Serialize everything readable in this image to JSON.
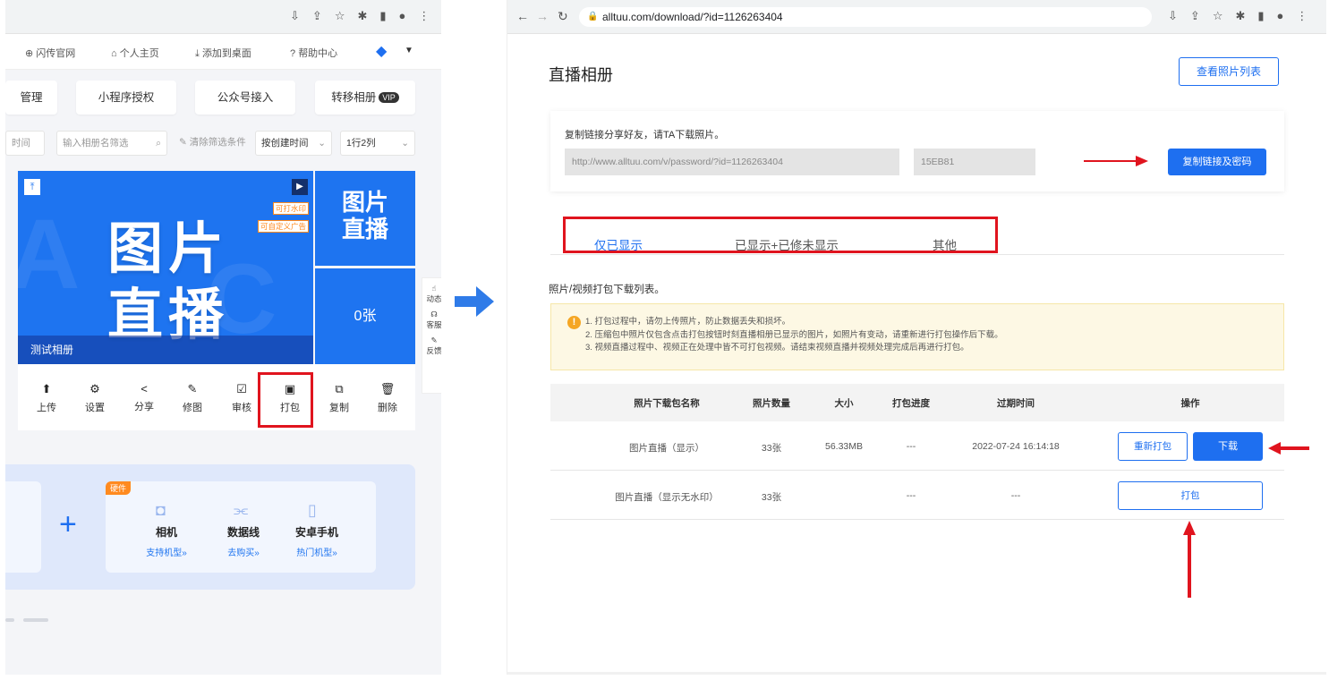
{
  "left_panel": {
    "nav": {
      "official_site": "闪传官网",
      "personal_home": "个人主页",
      "add_to_desktop": "添加到桌面",
      "help_center": "帮助中心"
    },
    "nav_icons": [
      "globe-icon",
      "home-icon",
      "download-icon",
      "help-icon"
    ],
    "cards": {
      "manage": "管理",
      "miniprogram_auth": "小程序授权",
      "official_account": "公众号接入",
      "transfer_album": "转移相册",
      "vip_badge": "VIP"
    },
    "filters": {
      "time_stub": "时间",
      "search_placeholder": "输入相册名筛选",
      "clear_filters": "清除筛选条件",
      "sort_by": "按创建时间",
      "layout": "1行2列"
    },
    "cover": {
      "title_line1": "图片",
      "title_line2": "直播",
      "tag_watermark": "可打水印",
      "tag_custom_ad": "可自定义广告",
      "caption": "测试相册"
    },
    "side_tiles": {
      "top_line1": "图片",
      "top_line2": "直播",
      "count": "0张"
    },
    "float_rail": {
      "activity": "动态",
      "service": "客服",
      "feedback": "反馈"
    },
    "tools": [
      {
        "label": "上传",
        "icon": "upload-icon"
      },
      {
        "label": "设置",
        "icon": "gear-icon"
      },
      {
        "label": "分享",
        "icon": "share-icon"
      },
      {
        "label": "修图",
        "icon": "edit-image-icon"
      },
      {
        "label": "审核",
        "icon": "review-icon"
      },
      {
        "label": "打包",
        "icon": "package-icon"
      },
      {
        "label": "复制",
        "icon": "copy-icon"
      },
      {
        "label": "删除",
        "icon": "trash-icon"
      }
    ],
    "hardware": {
      "badge": "硬件",
      "items": [
        {
          "name": "相机",
          "link": "支持机型»"
        },
        {
          "name": "数据线",
          "link": "去购买»"
        },
        {
          "name": "安卓手机",
          "link": "热门机型»"
        }
      ]
    }
  },
  "right_panel": {
    "browser": {
      "url": "alltuu.com/download/?id=1126263404"
    },
    "page_title": "直播相册",
    "view_list_button": "查看照片列表",
    "share": {
      "heading": "复制链接分享好友，请TA下载照片。",
      "link_value": "http://www.alltuu.com/v/password/?id=1126263404",
      "password_value": "15EB81",
      "copy_button": "复制链接及密码"
    },
    "tabs": [
      "仅已显示",
      "已显示+已修未显示",
      "其他"
    ],
    "list_title": "照片/视频打包下载列表。",
    "notices": [
      "1. 打包过程中，请勿上传照片，防止数据丢失和损坏。",
      "2. 压缩包中照片仅包含点击打包按钮时刻直播相册已显示的图片，如照片有变动，请重新进行打包操作后下载。",
      "3. 视频直播过程中、视频正在处理中皆不可打包视频。请结束视频直播并视频处理完成后再进行打包。"
    ],
    "table": {
      "headers": [
        "照片下载包名称",
        "照片数量",
        "大小",
        "打包进度",
        "过期时间",
        "操作"
      ],
      "rows": [
        {
          "name": "图片直播（显示）",
          "count": "33张",
          "size": "56.33MB",
          "progress": "---",
          "expires": "2022-07-24 16:14:18",
          "action1": "重新打包",
          "action2": "下载"
        },
        {
          "name": "图片直播（显示无水印）",
          "count": "33张",
          "size": "",
          "progress": "---",
          "expires": "---",
          "action1": "打包"
        }
      ]
    }
  },
  "colors": {
    "accent_blue": "#1e6ff0",
    "annotation_red": "#e0141e",
    "notice_bg": "#fdf8e4"
  }
}
